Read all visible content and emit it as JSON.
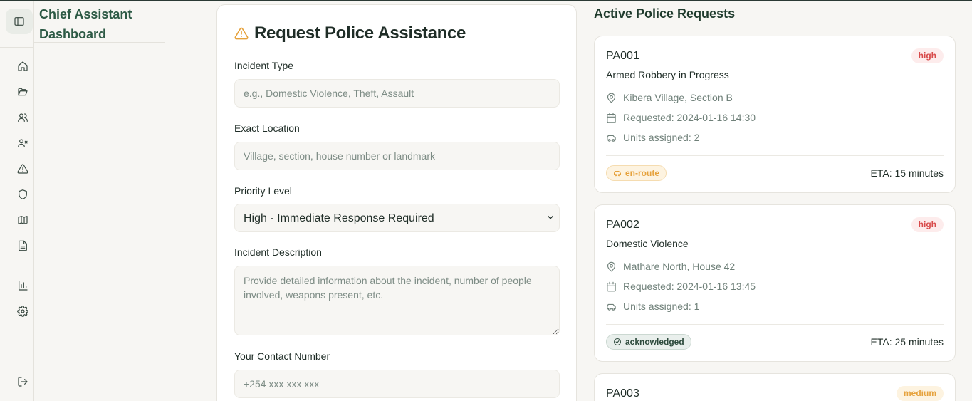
{
  "app": {
    "title": "Chief Assistant Dashboard"
  },
  "nav": {
    "items": [
      {
        "icon": "home-icon"
      },
      {
        "icon": "folder-open-icon"
      },
      {
        "icon": "users-icon"
      },
      {
        "icon": "user-x-icon"
      },
      {
        "icon": "alert-triangle-icon"
      },
      {
        "icon": "shield-icon"
      },
      {
        "icon": "map-icon"
      },
      {
        "icon": "file-text-icon"
      },
      {
        "icon": "bar-chart-icon"
      },
      {
        "icon": "settings-icon"
      }
    ],
    "logout_icon": "log-out-icon"
  },
  "form": {
    "title": "Request Police Assistance",
    "incident_type": {
      "label": "Incident Type",
      "value": "",
      "placeholder": "e.g., Domestic Violence, Theft, Assault"
    },
    "location": {
      "label": "Exact Location",
      "value": "",
      "placeholder": "Village, section, house number or landmark"
    },
    "priority": {
      "label": "Priority Level",
      "selected": "High - Immediate Response Required"
    },
    "description": {
      "label": "Incident Description",
      "value": "",
      "placeholder": "Provide detailed information about the incident, number of people involved, weapons present, etc."
    },
    "contact": {
      "label": "Your Contact Number",
      "value": "",
      "placeholder": "+254 xxx xxx xxx"
    }
  },
  "requests": {
    "title": "Active Police Requests",
    "items": [
      {
        "id": "PA001",
        "type": "Armed Robbery in Progress",
        "priority": "high",
        "location": "Kibera Village, Section B",
        "requested": "Requested: 2024-01-16 14:30",
        "units": "Units assigned: 2",
        "status": "en-route",
        "eta": "ETA: 15 minutes"
      },
      {
        "id": "PA002",
        "type": "Domestic Violence",
        "priority": "high",
        "location": "Mathare North, House 42",
        "requested": "Requested: 2024-01-16 13:45",
        "units": "Units assigned: 1",
        "status": "acknowledged",
        "eta": "ETA: 25 minutes"
      },
      {
        "id": "PA003",
        "priority": "medium"
      }
    ]
  },
  "colors": {
    "accent": "#2d5a45",
    "high": "#d84a4a",
    "medium": "#e6a23c"
  }
}
